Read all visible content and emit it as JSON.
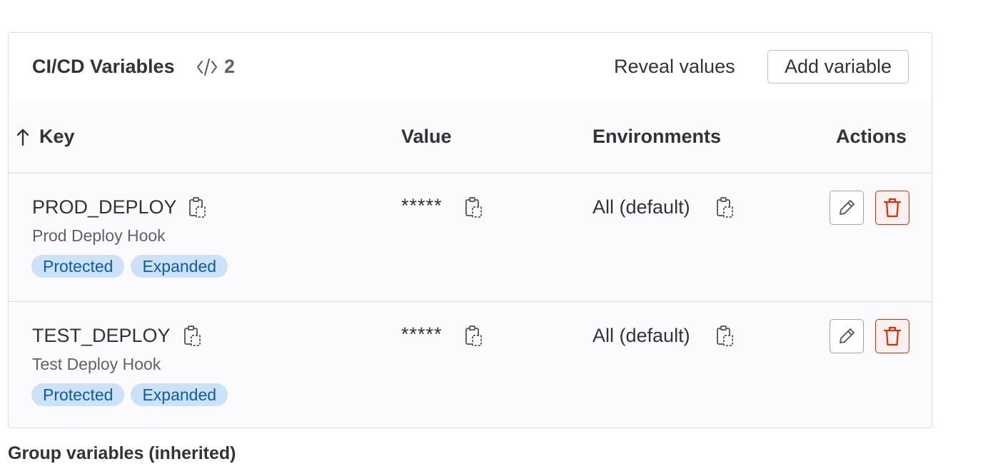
{
  "header": {
    "title": "CI/CD Variables",
    "count": "2",
    "reveal_label": "Reveal values",
    "add_label": "Add variable"
  },
  "table": {
    "columns": [
      "Key",
      "Value",
      "Environments",
      "Actions"
    ],
    "rows": [
      {
        "key": "PROD_DEPLOY",
        "description": "Prod Deploy Hook",
        "badges": [
          "Protected",
          "Expanded"
        ],
        "value": "*****",
        "environment": "All (default)"
      },
      {
        "key": "TEST_DEPLOY",
        "description": "Test Deploy Hook",
        "badges": [
          "Protected",
          "Expanded"
        ],
        "value": "*****",
        "environment": "All (default)"
      }
    ]
  },
  "group_section": {
    "title": "Group variables (inherited)"
  },
  "icons": {
    "sort": "arrow-up-icon",
    "code": "code-icon",
    "copy": "copy-to-clipboard-icon",
    "edit": "pencil-icon",
    "delete": "trash-icon"
  },
  "colors": {
    "badge_bg": "#cbe2f9",
    "badge_text": "#0b5cad",
    "danger": "#dd2b0e",
    "border": "#dcdcde"
  }
}
